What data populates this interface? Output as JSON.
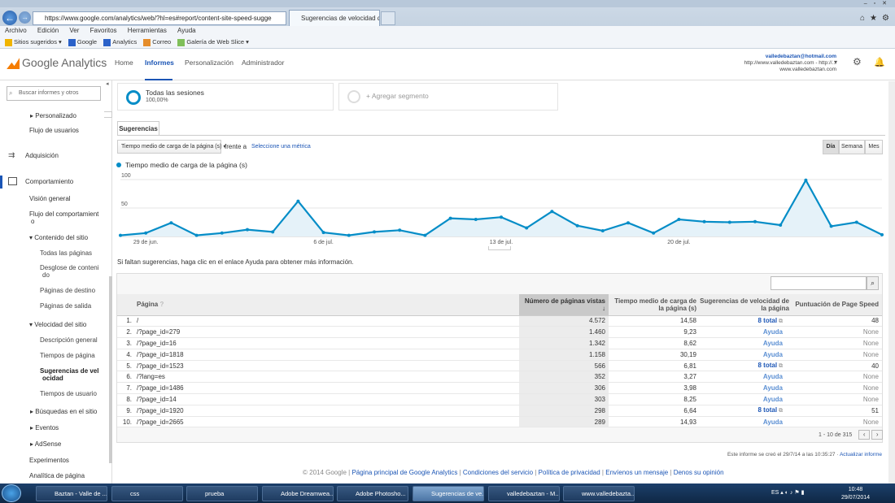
{
  "browser": {
    "url": "https://www.google.com/analytics/web/?hl=es#report/content-site-speed-sugge",
    "tab_title": "Sugerencias de velocidad d...",
    "menu": [
      "Archivo",
      "Edición",
      "Ver",
      "Favoritos",
      "Herramientas",
      "Ayuda"
    ],
    "favorites": [
      "Sitios sugeridos",
      "Google",
      "Analytics",
      "Correo",
      "Galería de Web Slice"
    ]
  },
  "ga": {
    "logo": "Google Analytics",
    "nav": [
      "Home",
      "Informes",
      "Personalización",
      "Administrador"
    ],
    "active_nav": "Informes",
    "account_email": "valledebaztan@hotmail.com",
    "account_site": "http://www.valledebaztan.com - http://...",
    "account_prop": "www.valledebaztan.com"
  },
  "sidebar": {
    "search_placeholder": "Buscar informes y otros",
    "items": [
      {
        "label": "Personalizado",
        "level": 1
      },
      {
        "label": "Flujo de usuarios",
        "level": 1
      },
      {
        "label": "Adquisición",
        "level": 0
      },
      {
        "label": "Comportamiento",
        "level": 0
      },
      {
        "label": "Visión general",
        "level": 1
      },
      {
        "label": "Flujo del comportamient",
        "level": 1
      },
      {
        "label": "o",
        "level": 1
      },
      {
        "label": "Contenido del sitio",
        "level": 1
      },
      {
        "label": "Todas las páginas",
        "level": 2
      },
      {
        "label": "Desglose de conteni",
        "level": 2
      },
      {
        "label": "do",
        "level": 2
      },
      {
        "label": "Páginas de destino",
        "level": 2
      },
      {
        "label": "Páginas de salida",
        "level": 2
      },
      {
        "label": "Velocidad del sitio",
        "level": 1
      },
      {
        "label": "Descripción general",
        "level": 2
      },
      {
        "label": "Tiempos de página",
        "level": 2
      },
      {
        "label": "Sugerencias de vel",
        "level": 2
      },
      {
        "label": "ocidad",
        "level": 2
      },
      {
        "label": "Tiempos de usuario",
        "level": 2
      },
      {
        "label": "Búsquedas en el sitio",
        "level": 1
      },
      {
        "label": "Eventos",
        "level": 1
      },
      {
        "label": "AdSense",
        "level": 1
      },
      {
        "label": "Experimentos",
        "level": 1
      },
      {
        "label": "Analítica de página",
        "level": 1
      }
    ]
  },
  "segments": {
    "seg1_title": "Todas las sesiones",
    "seg1_pct": "100,00%",
    "seg2_title": "+ Agregar segmento"
  },
  "report": {
    "tab": "Sugerencias",
    "metric": "Tiempo medio de carga de la página (s)",
    "vs": "frente a",
    "select_metric": "Seleccione una métrica",
    "periods": [
      "Día",
      "Semana",
      "Mes"
    ],
    "note": "Si faltan sugerencias, haga clic en el enlace Ayuda para obtener más información.",
    "pager": "1 - 10 de 315",
    "created": "Este informe se creó el 29/7/14 a las 10:35:27 · ",
    "update": "Actualizar informe"
  },
  "chart_data": {
    "type": "area",
    "series": [
      {
        "name": "Tiempo medio de carga de la página (s)",
        "color": "#058dc7",
        "values": [
          2,
          6,
          24,
          2,
          6,
          12,
          8,
          62,
          7,
          2,
          8,
          11,
          2,
          32,
          30,
          34,
          15,
          44,
          19,
          10,
          24,
          6,
          30,
          26,
          25,
          26,
          20,
          99,
          18,
          25,
          3
        ]
      }
    ],
    "x_tick_labels": [
      {
        "label": "29 de jun.",
        "index": 1
      },
      {
        "label": "6 de jul.",
        "index": 8
      },
      {
        "label": "13 de jul.",
        "index": 15
      },
      {
        "label": "20 de jul.",
        "index": 22
      }
    ],
    "y_ticks": [
      50,
      100
    ],
    "ylim": [
      0,
      110
    ]
  },
  "table": {
    "headers": [
      "Página",
      "Número de páginas vistas",
      "Tiempo medio de carga de la página (s)",
      "Sugerencias de velocidad de la página",
      "Puntuación de Page Speed"
    ],
    "rows": [
      [
        "1.",
        "/",
        "4.572",
        "14,58",
        "8 total",
        "48"
      ],
      [
        "2.",
        "/?page_id=279",
        "1.460",
        "9,23",
        "Ayuda",
        "None"
      ],
      [
        "3.",
        "/?page_id=16",
        "1.342",
        "8,62",
        "Ayuda",
        "None"
      ],
      [
        "4.",
        "/?page_id=1818",
        "1.158",
        "30,19",
        "Ayuda",
        "None"
      ],
      [
        "5.",
        "/?page_id=1523",
        "566",
        "6,81",
        "8 total",
        "40"
      ],
      [
        "6.",
        "/?lang=es",
        "352",
        "3,27",
        "Ayuda",
        "None"
      ],
      [
        "7.",
        "/?page_id=1486",
        "306",
        "3,98",
        "Ayuda",
        "None"
      ],
      [
        "8.",
        "/?page_id=14",
        "303",
        "8,25",
        "Ayuda",
        "None"
      ],
      [
        "9.",
        "/?page_id=1920",
        "298",
        "6,64",
        "8 total",
        "51"
      ],
      [
        "10.",
        "/?page_id=2665",
        "289",
        "14,93",
        "Ayuda",
        "None"
      ]
    ]
  },
  "footer": {
    "copyright": "© 2014 Google",
    "links": [
      "Página principal de Google Analytics",
      "Condiciones del servicio",
      "Política de privacidad",
      "Envíenos un mensaje",
      "Denos su opinión"
    ]
  },
  "taskbar": {
    "items": [
      "Baztan - Valle de ...",
      "css",
      "prueba",
      "Adobe Dreamwea...",
      "Adobe Photosho...",
      "Sugerencias de ve...",
      "valledebaztan - M...",
      "www.valledebazta..."
    ],
    "lang": "ES",
    "time": "10:48",
    "date": "29/07/2014"
  }
}
